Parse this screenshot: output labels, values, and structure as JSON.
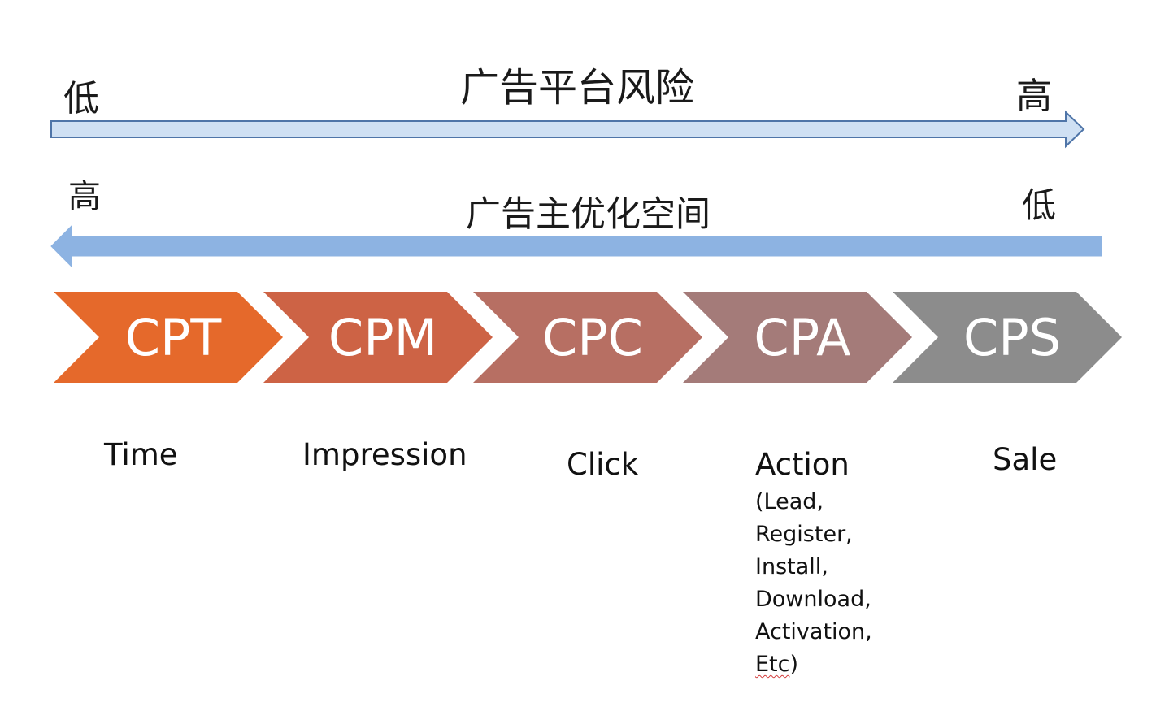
{
  "risk_axis": {
    "title": "广告平台风险",
    "left": "低",
    "right": "高"
  },
  "optimization_axis": {
    "title": "广告主优化空间",
    "left": "高",
    "right": "低"
  },
  "chevrons": [
    {
      "label": "CPT",
      "color": "#E5692B"
    },
    {
      "label": "CPM",
      "color": "#CD6345"
    },
    {
      "label": "CPC",
      "color": "#B76F63"
    },
    {
      "label": "CPA",
      "color": "#A47B79"
    },
    {
      "label": "CPS",
      "color": "#8C8C8C"
    }
  ],
  "captions": [
    "Time",
    "Impression",
    "Click",
    "Action",
    "Sale"
  ],
  "action_details": [
    "(Lead,",
    "Register,",
    "Install,",
    "Download,",
    "Activation,"
  ],
  "action_last": {
    "text": "Etc",
    "close": ")"
  },
  "colors": {
    "arrow_top_fill": "#CFE0F3",
    "arrow_top_stroke": "#4F75A8",
    "arrow_bottom_fill": "#8DB3E2"
  }
}
